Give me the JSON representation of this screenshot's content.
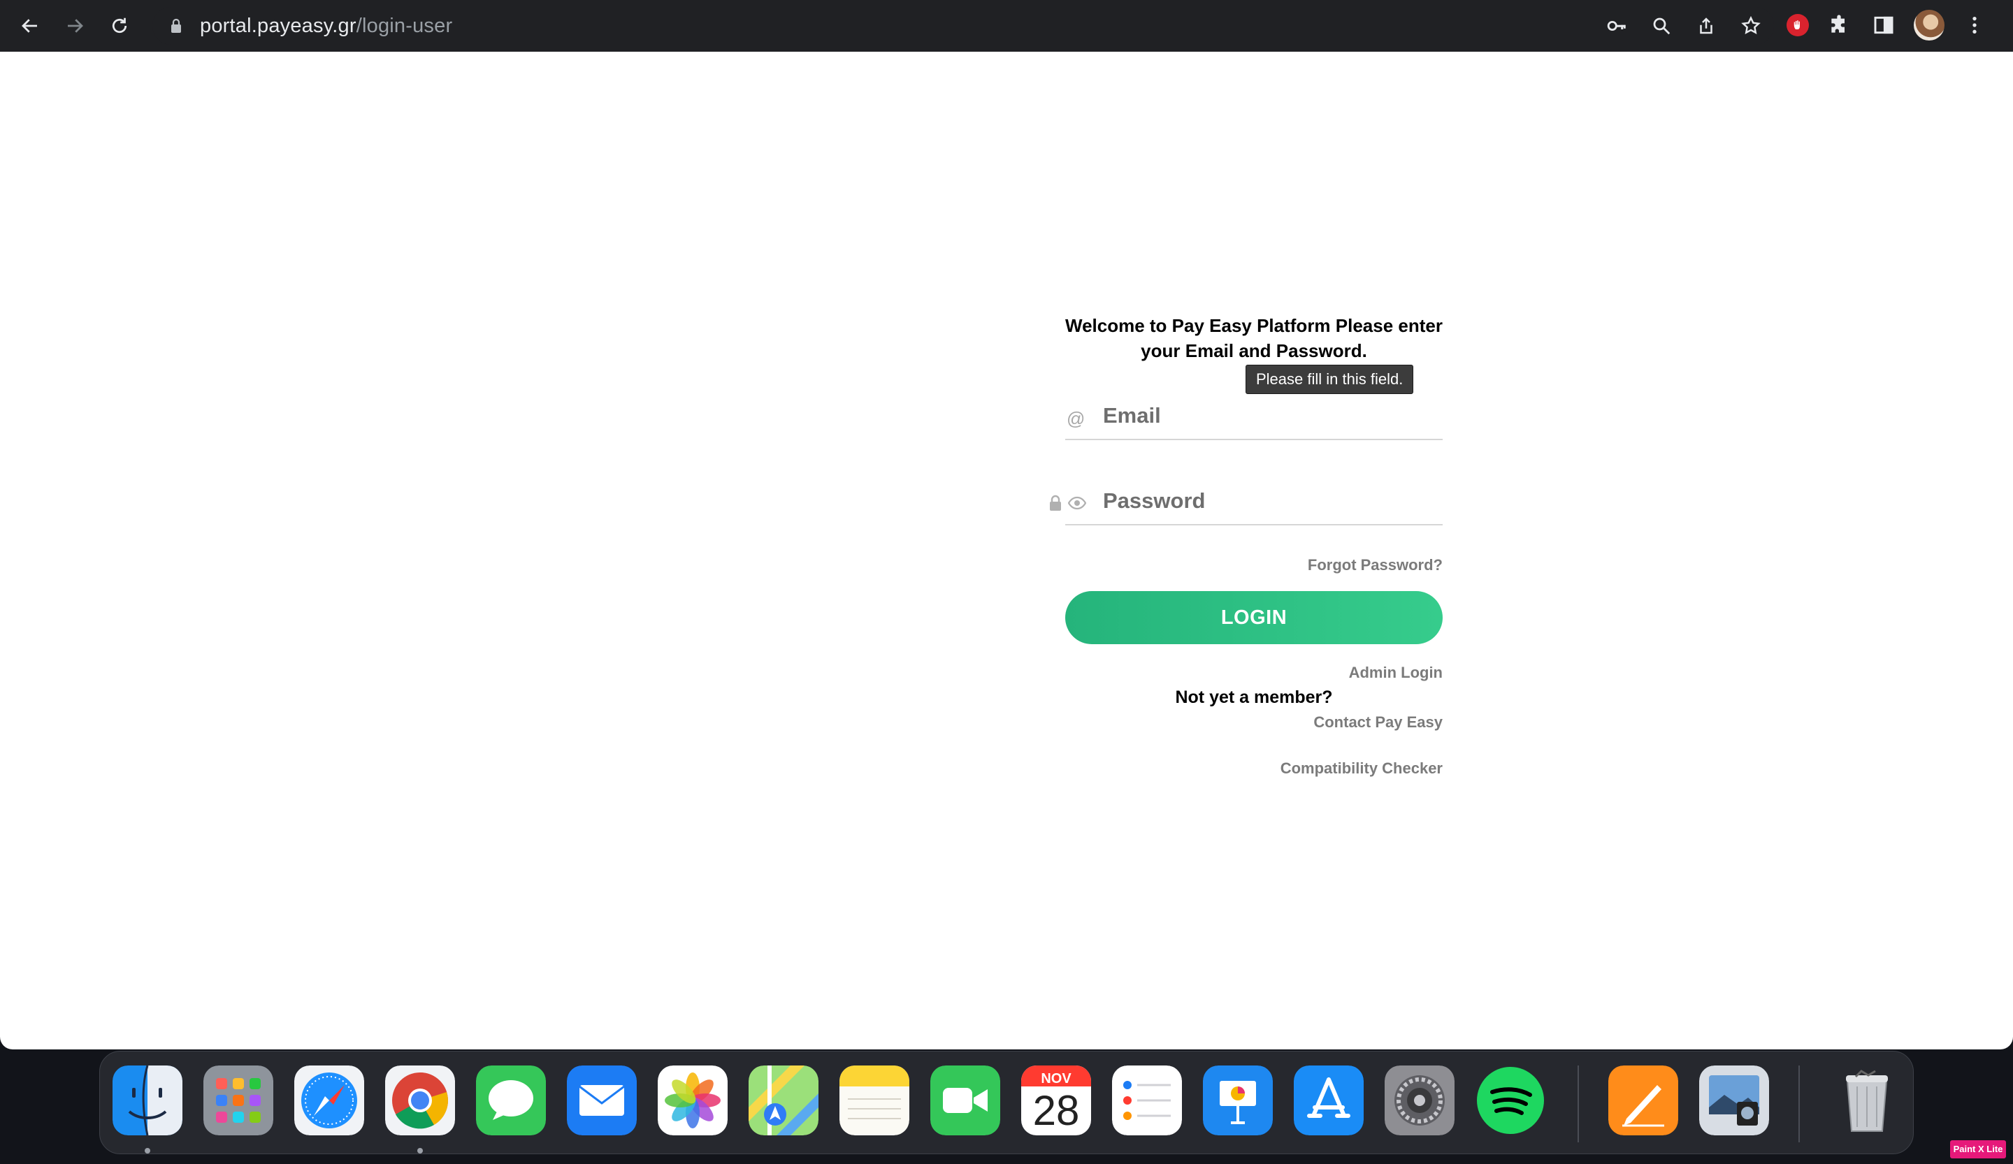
{
  "browser": {
    "url_host": "portal.payeasy.gr",
    "url_path": "/login-user"
  },
  "login": {
    "welcome": "Welcome to Pay Easy Platform Please enter your Email and Password.",
    "email_placeholder": "Email",
    "email_value": "",
    "password_placeholder": "Password",
    "password_value": "",
    "validation_tooltip": "Please fill in this field.",
    "forgot_password": "Forgot Password?",
    "login_button": "LOGIN",
    "admin_login": "Admin Login",
    "not_member": "Not yet a member?",
    "contact": "Contact Pay Easy",
    "compatibility": "Compatibility Checker",
    "button_color": "#2ebf82"
  },
  "dock": {
    "calendar_month": "NOV",
    "calendar_day": "28",
    "apps": [
      "finder",
      "launchpad",
      "safari",
      "chrome",
      "messages",
      "mail",
      "photos",
      "maps",
      "notes",
      "facetime",
      "calendar",
      "reminders",
      "keynote",
      "app-store",
      "system-settings",
      "spotify",
      "pages",
      "preview",
      "trash"
    ]
  },
  "watermark": "Paint X Lite"
}
